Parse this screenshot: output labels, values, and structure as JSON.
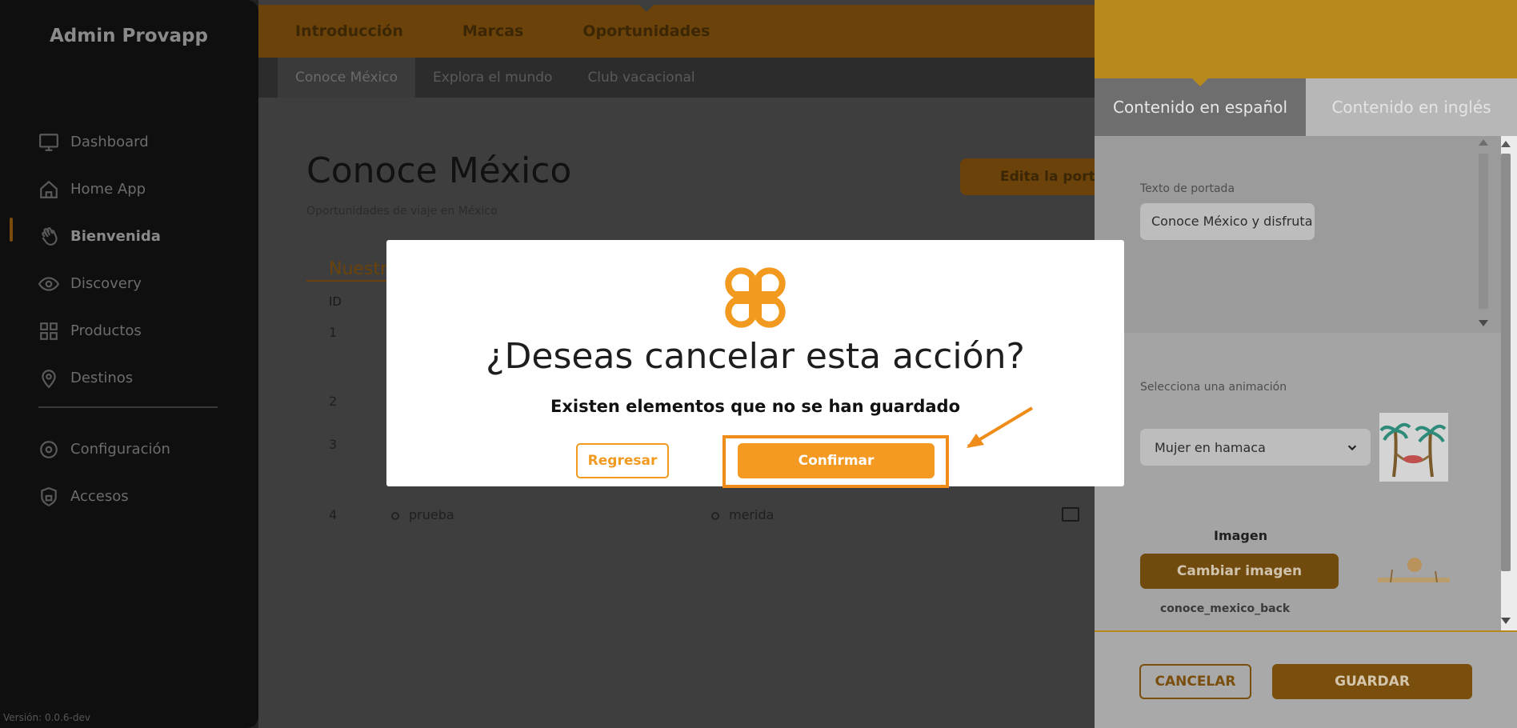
{
  "sidebar": {
    "brand": "Admin Provapp",
    "items": [
      {
        "label": "Dashboard",
        "icon": "monitor-icon"
      },
      {
        "label": "Home App",
        "icon": "home-icon"
      },
      {
        "label": "Bienvenida",
        "icon": "waving-hand-icon"
      },
      {
        "label": "Discovery",
        "icon": "eye-icon"
      },
      {
        "label": "Productos",
        "icon": "grid-icon"
      },
      {
        "label": "Destinos",
        "icon": "map-pin-icon"
      }
    ],
    "items2": [
      {
        "label": "Configuración",
        "icon": "gear-icon"
      },
      {
        "label": "Accesos",
        "icon": "shield-lock-icon"
      }
    ],
    "active": "Bienvenida",
    "version": "Versión: 0.0.6-dev"
  },
  "topnav": {
    "tabs": [
      "Introducción",
      "Marcas",
      "Oportunidades"
    ],
    "selected": "Oportunidades"
  },
  "subnav": {
    "tabs": [
      "Conoce México",
      "Explora el mundo",
      "Club vacacional"
    ],
    "selected": "Conoce México"
  },
  "main": {
    "title": "Conoce México",
    "subtitle": "Oportunidades de viaje en México",
    "edit_button": "Edita la port",
    "section_heading": "Nuestr",
    "col_id": "ID",
    "rows": [
      {
        "id": "1"
      },
      {
        "id": "2"
      },
      {
        "id": "3"
      },
      {
        "id": "4",
        "name": "prueba",
        "destination": "merida"
      }
    ]
  },
  "panel": {
    "tabs": [
      "Contenido en español",
      "Contenido en inglés"
    ],
    "cover_label": "Texto de portada",
    "cover_value": "Conoce México y disfruta de n",
    "animation_label": "Selecciona una animación",
    "animation_value": "Mujer en hamaca",
    "image_label": "Imagen",
    "change_image": "Cambiar imagen",
    "file_name": "conoce_mexico_back",
    "cancel": "CANCELAR",
    "save": "GUARDAR"
  },
  "modal": {
    "title": "¿Deseas cancelar esta acción?",
    "subtitle": "Existen elementos que no se han guardado",
    "back": "Regresar",
    "confirm": "Confirmar"
  },
  "colors": {
    "accent": "#f49a22",
    "panel_header": "#b88a1e",
    "sidebar": "#0f0f0f"
  }
}
